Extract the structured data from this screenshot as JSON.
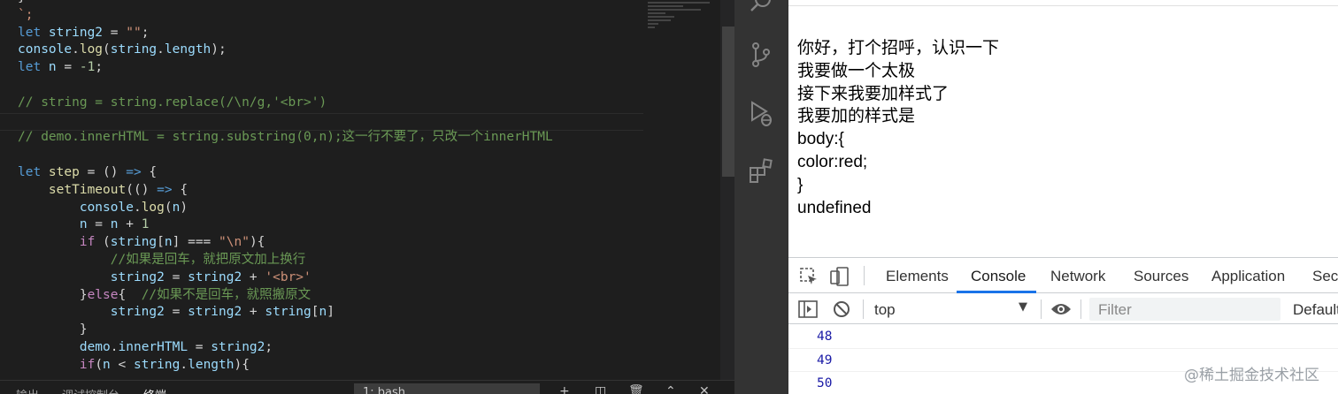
{
  "editor": {
    "lines": [
      [
        {
          "t": "}",
          "c": "o"
        }
      ],
      [
        {
          "t": "`;",
          "c": "s"
        }
      ],
      [
        {
          "t": "let ",
          "c": "k"
        },
        {
          "t": "string2",
          "c": "v"
        },
        {
          "t": " = ",
          "c": "o"
        },
        {
          "t": "\"\"",
          "c": "s"
        },
        {
          "t": ";",
          "c": "o"
        }
      ],
      [
        {
          "t": "console",
          "c": "v"
        },
        {
          "t": ".",
          "c": "o"
        },
        {
          "t": "log",
          "c": "f"
        },
        {
          "t": "(",
          "c": "o"
        },
        {
          "t": "string",
          "c": "v"
        },
        {
          "t": ".",
          "c": "o"
        },
        {
          "t": "length",
          "c": "v"
        },
        {
          "t": ");",
          "c": "o"
        }
      ],
      [
        {
          "t": "let ",
          "c": "k"
        },
        {
          "t": "n",
          "c": "v"
        },
        {
          "t": " = ",
          "c": "o"
        },
        {
          "t": "-1",
          "c": "n"
        },
        {
          "t": ";",
          "c": "o"
        }
      ],
      [
        {
          "t": "",
          "c": "o"
        }
      ],
      [
        {
          "t": "// string = string.replace(/\\n/g,'<br>')",
          "c": "c"
        }
      ],
      [
        {
          "t": "",
          "c": "o"
        }
      ],
      [
        {
          "t": "// demo.innerHTML = string.substring(0,n);这一行不要了，只改一个innerHTML",
          "c": "c"
        }
      ],
      [
        {
          "t": "",
          "c": "o"
        }
      ],
      [
        {
          "t": "let ",
          "c": "k"
        },
        {
          "t": "step",
          "c": "f"
        },
        {
          "t": " = () ",
          "c": "o"
        },
        {
          "t": "=>",
          "c": "k"
        },
        {
          "t": " {",
          "c": "o"
        }
      ],
      [
        {
          "t": "    ",
          "c": "o"
        },
        {
          "t": "setTimeout",
          "c": "f"
        },
        {
          "t": "(() ",
          "c": "o"
        },
        {
          "t": "=>",
          "c": "k"
        },
        {
          "t": " {",
          "c": "o"
        }
      ],
      [
        {
          "t": "        ",
          "c": "o"
        },
        {
          "t": "console",
          "c": "v"
        },
        {
          "t": ".",
          "c": "o"
        },
        {
          "t": "log",
          "c": "f"
        },
        {
          "t": "(",
          "c": "o"
        },
        {
          "t": "n",
          "c": "v"
        },
        {
          "t": ")",
          "c": "o"
        }
      ],
      [
        {
          "t": "        ",
          "c": "o"
        },
        {
          "t": "n",
          "c": "v"
        },
        {
          "t": " = ",
          "c": "o"
        },
        {
          "t": "n",
          "c": "v"
        },
        {
          "t": " + ",
          "c": "o"
        },
        {
          "t": "1",
          "c": "n"
        }
      ],
      [
        {
          "t": "        ",
          "c": "o"
        },
        {
          "t": "if",
          "c": "p"
        },
        {
          "t": " (",
          "c": "o"
        },
        {
          "t": "string",
          "c": "v"
        },
        {
          "t": "[",
          "c": "o"
        },
        {
          "t": "n",
          "c": "v"
        },
        {
          "t": "] === ",
          "c": "o"
        },
        {
          "t": "\"\\n\"",
          "c": "s"
        },
        {
          "t": "){",
          "c": "o"
        }
      ],
      [
        {
          "t": "            ",
          "c": "o"
        },
        {
          "t": "//如果是回车，就把原文加上换行",
          "c": "c"
        }
      ],
      [
        {
          "t": "            ",
          "c": "o"
        },
        {
          "t": "string2",
          "c": "v"
        },
        {
          "t": " = ",
          "c": "o"
        },
        {
          "t": "string2",
          "c": "v"
        },
        {
          "t": " + ",
          "c": "o"
        },
        {
          "t": "'<br>'",
          "c": "s"
        }
      ],
      [
        {
          "t": "        }",
          "c": "o"
        },
        {
          "t": "else",
          "c": "p"
        },
        {
          "t": "{  ",
          "c": "o"
        },
        {
          "t": "//如果不是回车，就照搬原文",
          "c": "c"
        }
      ],
      [
        {
          "t": "            ",
          "c": "o"
        },
        {
          "t": "string2",
          "c": "v"
        },
        {
          "t": " = ",
          "c": "o"
        },
        {
          "t": "string2",
          "c": "v"
        },
        {
          "t": " + ",
          "c": "o"
        },
        {
          "t": "string",
          "c": "v"
        },
        {
          "t": "[",
          "c": "o"
        },
        {
          "t": "n",
          "c": "v"
        },
        {
          "t": "]",
          "c": "o"
        }
      ],
      [
        {
          "t": "        }",
          "c": "o"
        }
      ],
      [
        {
          "t": "        ",
          "c": "o"
        },
        {
          "t": "demo",
          "c": "v"
        },
        {
          "t": ".",
          "c": "o"
        },
        {
          "t": "innerHTML",
          "c": "v"
        },
        {
          "t": " = ",
          "c": "o"
        },
        {
          "t": "string2",
          "c": "v"
        },
        {
          "t": ";",
          "c": "o"
        }
      ],
      [
        {
          "t": "        ",
          "c": "o"
        },
        {
          "t": "if",
          "c": "p"
        },
        {
          "t": "(",
          "c": "o"
        },
        {
          "t": "n",
          "c": "v"
        },
        {
          "t": " < ",
          "c": "o"
        },
        {
          "t": "string",
          "c": "v"
        },
        {
          "t": ".",
          "c": "o"
        },
        {
          "t": "length",
          "c": "v"
        },
        {
          "t": "){",
          "c": "o"
        }
      ]
    ]
  },
  "bottom_panel": {
    "tabs": [
      "输出",
      "调试控制台",
      "终端"
    ],
    "terminal_select": "1: bash"
  },
  "activity_bar": {
    "icons": [
      "search-icon",
      "source-control-icon",
      "run-debug-icon",
      "extensions-icon"
    ]
  },
  "browser": {
    "page_lines": [
      "你好，打个招呼，认识一下",
      "我要做一个太极",
      "接下来我要加样式了",
      "我要加的样式是",
      "body:{",
      "color:red;",
      "}",
      "undefined"
    ]
  },
  "devtools": {
    "tabs": [
      "Elements",
      "Console",
      "Network",
      "Sources",
      "Application",
      "Secu"
    ],
    "active_tab": "Console",
    "context": "top",
    "filter_placeholder": "Filter",
    "levels": "Default",
    "log_values": [
      "48",
      "49",
      "50"
    ]
  },
  "watermark": "@稀土掘金技术社区",
  "colors": {
    "editor_bg": "#1e1e1e",
    "activity_bar": "#333333",
    "accent": "#1a73e8",
    "console_number": "#1a1aa6"
  }
}
